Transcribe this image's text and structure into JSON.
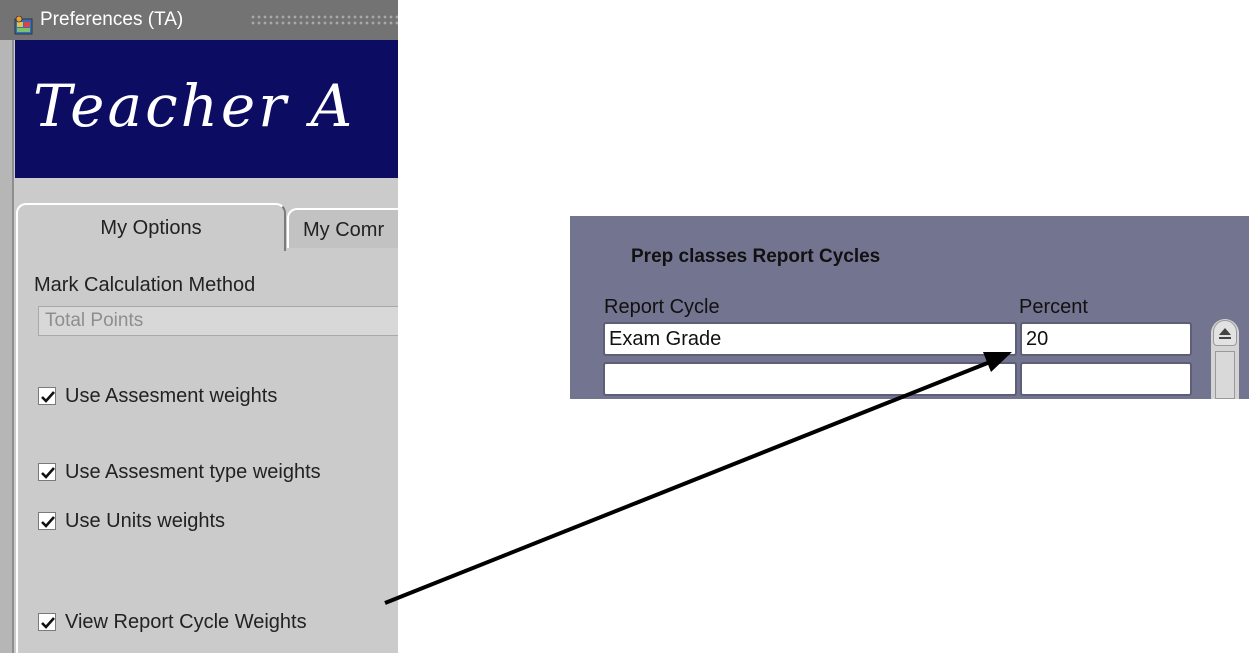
{
  "window": {
    "title": "Preferences (TA)",
    "brand_text": "Teacher A",
    "tabs": [
      {
        "label": "My Options",
        "active": true
      },
      {
        "label": "My Comr",
        "active": false
      }
    ],
    "mark_calc_label": "Mark Calculation Method",
    "mark_calc_value": "Total Points",
    "checkboxes": [
      {
        "label": "Use Assesment weights",
        "checked": true
      },
      {
        "label": "Use Assesment type weights",
        "checked": true
      },
      {
        "label": "Use Units weights",
        "checked": true
      },
      {
        "label": "View Report Cycle Weights",
        "checked": true
      }
    ]
  },
  "popup": {
    "title": "Prep classes Report Cycles",
    "columns": [
      "Report Cycle",
      "Percent"
    ],
    "rows": [
      {
        "report_cycle": "Exam Grade",
        "percent": "20"
      },
      {
        "report_cycle": "",
        "percent": ""
      }
    ]
  },
  "colors": {
    "banner": "#0c0c62",
    "window_bg": "#cbcbcb",
    "popup_bg": "#737490",
    "title_bar": "#737373",
    "arrow": "#000000"
  },
  "icons": {
    "app": "app-icon",
    "check": "checkmark-icon",
    "scroll_up": "scroll-up-icon"
  }
}
